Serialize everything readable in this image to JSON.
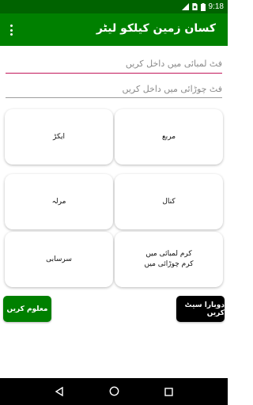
{
  "status_bar": {
    "time": "9:18",
    "icons": [
      "signal-icon",
      "sim-icon",
      "battery-icon"
    ]
  },
  "app_bar": {
    "title": "کسان زمین کیلکو لیٹر",
    "menu_icon": "more-vert-icon"
  },
  "inputs": {
    "length_placeholder": "فٹ لمبائی میں داخل کریں",
    "width_placeholder": "فٹ چوڑائی میں داخل کریں",
    "length_value": "",
    "width_value": ""
  },
  "grid": {
    "square_label": "مربع",
    "acre_label": "ایکڑ",
    "kanal_label": "کنال",
    "marla_label": "مرلہ",
    "karam_label": "کرم لمبائی میں\nکرم چوڑائی میں",
    "sarsahi_label": "سرسابی"
  },
  "actions": {
    "calculate_label": "معلوم کریں",
    "reset_label": "دوبارا سیٹ کریں"
  },
  "colors": {
    "status_bar": "#006300",
    "app_bar": "#008000",
    "accent_line": "#c2185b",
    "calculate_button": "#008000",
    "reset_button": "#000000"
  },
  "nav_bar": {
    "icons": [
      "back-icon",
      "home-icon",
      "recents-icon"
    ]
  }
}
